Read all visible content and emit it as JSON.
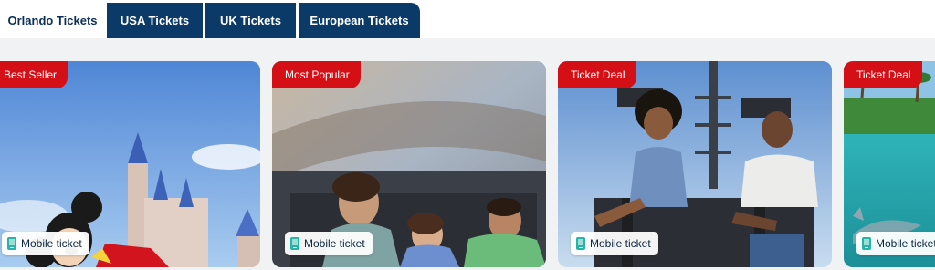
{
  "tabs": [
    {
      "label": "Orlando Tickets",
      "active": true
    },
    {
      "label": "USA Tickets",
      "active": false
    },
    {
      "label": "UK Tickets",
      "active": false
    },
    {
      "label": "European Tickets",
      "active": false
    }
  ],
  "cards": [
    {
      "badge": "Best Seller",
      "ticket_label": "Mobile ticket",
      "image": "mickey-castle-photo"
    },
    {
      "badge": "Most Popular",
      "ticket_label": "Mobile ticket",
      "image": "coaster-riders-photo"
    },
    {
      "badge": "Ticket Deal",
      "ticket_label": "Mobile ticket",
      "image": "thrill-ride-photo"
    },
    {
      "badge": "Ticket Deal",
      "ticket_label": "Mobile ticket",
      "image": "dolphin-lagoon-photo"
    }
  ],
  "colors": {
    "tab_active_text": "#0b2f5a",
    "tab_inactive_bg": "#0b3a68",
    "badge_bg": "#d50f16",
    "mobile_icon": "#27b3a6",
    "band_bg": "#f1f2f4"
  }
}
